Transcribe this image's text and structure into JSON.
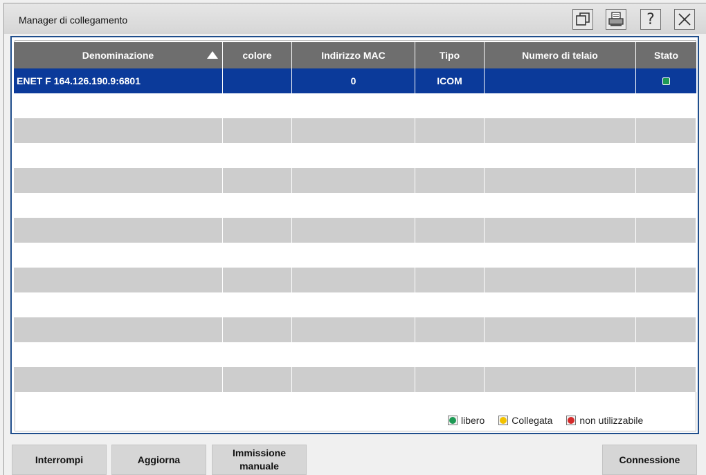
{
  "window": {
    "title": "Manager di collegamento",
    "title_buttons": [
      {
        "name": "restore-window-icon"
      },
      {
        "name": "print-icon"
      },
      {
        "name": "help-icon"
      },
      {
        "name": "close-icon"
      }
    ],
    "help_glyph": "?"
  },
  "table": {
    "columns": [
      "Denominazione",
      "colore",
      "Indirizzo MAC",
      "Tipo",
      "Numero di telaio",
      "Stato"
    ],
    "sort_column": "Denominazione",
    "sort_direction": "ascending",
    "rows": [
      {
        "denominazione": "ENET F 164.126.190.9:6801",
        "colore": "",
        "indirizzo_mac": "0",
        "tipo": "ICOM",
        "numero_di_telaio": "",
        "stato": "libero",
        "selected": true
      }
    ]
  },
  "legend": {
    "items": [
      {
        "label": "libero",
        "color": "#1e9a55"
      },
      {
        "label": "Collegata",
        "color": "#f2c200"
      },
      {
        "label": "non utilizzabile",
        "color": "#d42a2a"
      }
    ]
  },
  "buttons": {
    "interrompi": "Interrompi",
    "aggiorna": "Aggiorna",
    "immissione_line1": "Immissione",
    "immissione_line2": "manuale",
    "connessione": "Connessione"
  },
  "colors": {
    "selection": "#0b3a9a",
    "header": "#6e6e6e",
    "stripe": "#cdcdcd",
    "panel_border": "#1f4e8c"
  }
}
